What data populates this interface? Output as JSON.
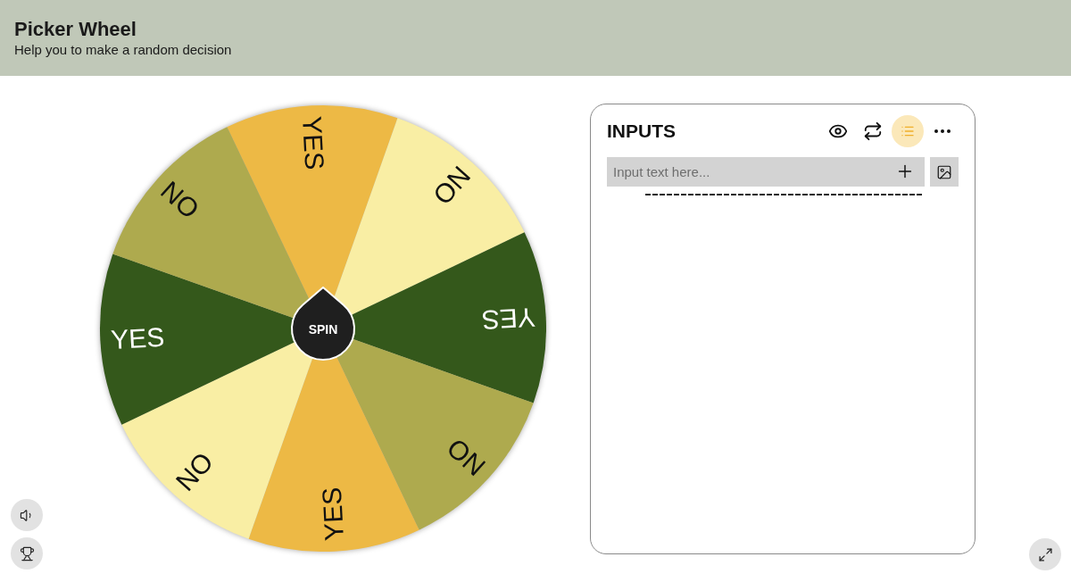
{
  "header": {
    "title": "Picker Wheel",
    "subtitle": "Help you to make a random decision"
  },
  "wheel": {
    "slices": [
      {
        "label": "YES",
        "color": "#edb945"
      },
      {
        "label": "NO",
        "color": "#f9eea4"
      },
      {
        "label": "YES",
        "color": "#34581b"
      },
      {
        "label": "NO",
        "color": "#aeaa4e"
      },
      {
        "label": "YES",
        "color": "#edb945"
      },
      {
        "label": "NO",
        "color": "#f9eea4"
      },
      {
        "label": "YES",
        "color": "#34581b"
      },
      {
        "label": "NO",
        "color": "#aeaa4e"
      }
    ],
    "spin_button": {
      "label": "SPIN"
    }
  },
  "inputs_panel": {
    "title": "INPUTS",
    "toolbar": [
      {
        "kind": "eye",
        "selected": false
      },
      {
        "kind": "repeat",
        "selected": false
      },
      {
        "kind": "list",
        "selected": true
      },
      {
        "kind": "more",
        "selected": false
      }
    ],
    "input": {
      "placeholder": "Input text here..."
    }
  }
}
